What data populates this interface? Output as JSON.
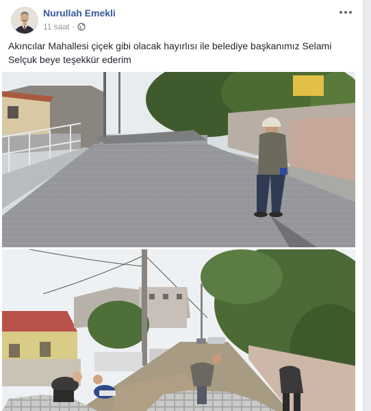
{
  "post": {
    "author_name": "Nurullah Emekli",
    "timestamp": "11 saat",
    "separator": "·",
    "privacy_icon": "globe-icon",
    "more_icon": "more-options-icon",
    "text": "Akıncılar Mahallesi çiçek gibi olacak hayırlısı ile belediye başkanımız Selami Selçuk beye teşekkür ederim"
  },
  "colors": {
    "author_link": "#365899",
    "meta_gray": "#90949c",
    "body_text": "#1d2129",
    "background": "#e9ebee"
  }
}
